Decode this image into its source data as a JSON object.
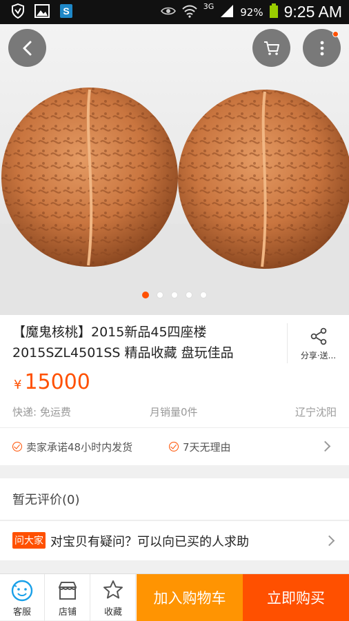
{
  "status_bar": {
    "network": "3G",
    "battery_percent": "92%",
    "time": "9:25 AM"
  },
  "product": {
    "title": "【魔鬼核桃】2015新品45四座楼2015SZL4501SS 精品收藏 盘玩佳品",
    "share_label": "分享·送...",
    "currency": "¥",
    "price": "15000",
    "shipping": "快递: 免运费",
    "monthly_sales": "月销量0件",
    "location": "辽宁沈阳",
    "image_pages": 5,
    "image_page_active": 1
  },
  "promises": [
    "卖家承诺48小时内发货",
    "7天无理由"
  ],
  "reviews": {
    "label": "暂无评价(0)"
  },
  "ask": {
    "badge": "问大家",
    "text": "对宝贝有疑问？可以向已买的人求助"
  },
  "tabbar": {
    "service": "客服",
    "shop": "店铺",
    "favorite": "收藏",
    "add_to_cart": "加入购物车",
    "buy_now": "立即购买"
  },
  "colors": {
    "accent": "#ff5000",
    "cart_button": "#ff9402",
    "buy_button": "#ff5000"
  }
}
